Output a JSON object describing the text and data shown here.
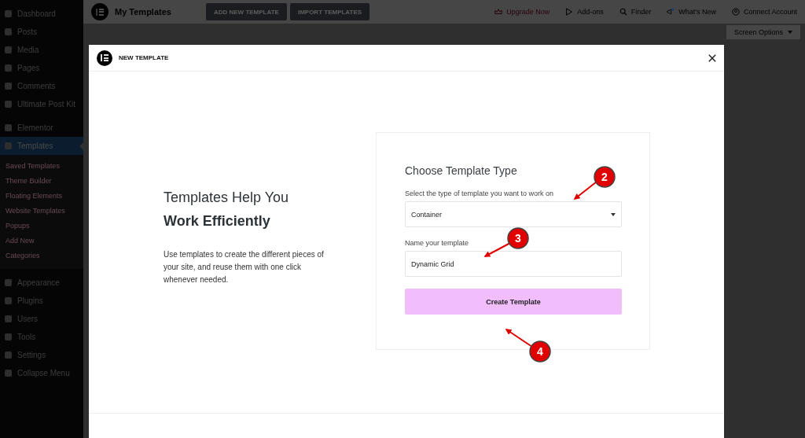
{
  "sidebar": {
    "items": [
      {
        "label": "Dashboard",
        "selected": false
      },
      {
        "label": "Posts",
        "selected": false
      },
      {
        "label": "Media",
        "selected": false
      },
      {
        "label": "Pages",
        "selected": false
      },
      {
        "label": "Comments",
        "selected": false
      },
      {
        "label": "Ultimate Post Kit",
        "selected": false
      },
      {
        "label": "Elementor",
        "selected": false
      },
      {
        "label": "Templates",
        "selected": true,
        "expanded": true,
        "children": [
          {
            "label": "Saved Templates"
          },
          {
            "label": "Theme Builder"
          },
          {
            "label": "Floating Elements"
          },
          {
            "label": "Website Templates"
          },
          {
            "label": "Popups"
          },
          {
            "label": "Add New"
          },
          {
            "label": "Categories"
          }
        ]
      },
      {
        "label": "Appearance",
        "selected": false
      },
      {
        "label": "Plugins",
        "selected": false
      },
      {
        "label": "Users",
        "selected": false
      },
      {
        "label": "Tools",
        "selected": false
      },
      {
        "label": "Settings",
        "selected": false
      },
      {
        "label": "Collapse Menu",
        "selected": false
      }
    ]
  },
  "topbar": {
    "title": "My Templates",
    "buttons": [
      "ADD NEW TEMPLATE",
      "IMPORT TEMPLATES"
    ],
    "links": [
      {
        "label": "Upgrade Now",
        "kind": "upgrade"
      },
      {
        "label": "Add-ons",
        "kind": "addons"
      },
      {
        "label": "Finder",
        "kind": "finder"
      },
      {
        "label": "What's New",
        "kind": "news"
      },
      {
        "label": "Connect Account",
        "kind": "account"
      }
    ],
    "screen_options": "Screen Options"
  },
  "modal": {
    "title": "NEW TEMPLATE",
    "intro": {
      "heading": "Templates Help You",
      "heading_bold": "Work Efficiently",
      "text": "Use templates to create the different pieces of your site, and reuse them with one click whenever needed."
    },
    "form": {
      "title": "Choose Template Type",
      "type_label": "Select the type of template you want to work on",
      "type_value": "Container",
      "name_label": "Name your template",
      "name_value": "Dynamic Grid",
      "button": "Create Template"
    }
  },
  "callouts": [
    "2",
    "3",
    "4"
  ]
}
